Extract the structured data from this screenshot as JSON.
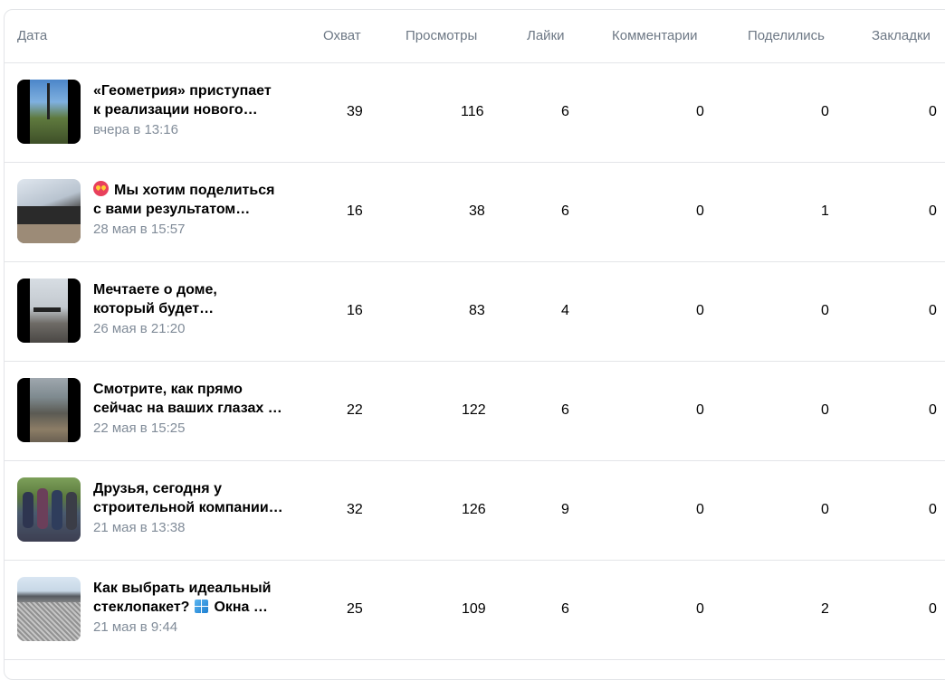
{
  "header": {
    "date": "Дата",
    "reach": "Охват",
    "views": "Просмотры",
    "likes": "Лайки",
    "comments": "Комментарии",
    "shares": "Поделились",
    "bookmarks": "Закладки"
  },
  "rows": [
    {
      "title_line1": "«Геометрия» приступает",
      "title_line2": "к реализации нового…",
      "date": "вчера в 13:16",
      "reach": "39",
      "views": "116",
      "likes": "6",
      "comments": "0",
      "shares": "0",
      "bookmarks": "0"
    },
    {
      "title_line1": "Мы хотим поделиться",
      "title_line2": "с вами результатом…",
      "date": "28 мая в 15:57",
      "reach": "16",
      "views": "38",
      "likes": "6",
      "comments": "0",
      "shares": "1",
      "bookmarks": "0",
      "emoji": "star-struck-icon"
    },
    {
      "title_line1": "Мечтаете о доме,",
      "title_line2": "который будет…",
      "date": "26 мая в 21:20",
      "reach": "16",
      "views": "83",
      "likes": "4",
      "comments": "0",
      "shares": "0",
      "bookmarks": "0"
    },
    {
      "title_line1": "Смотрите, как прямо",
      "title_line2": "сейчас на ваших глазах …",
      "date": "22 мая в 15:25",
      "reach": "22",
      "views": "122",
      "likes": "6",
      "comments": "0",
      "shares": "0",
      "bookmarks": "0"
    },
    {
      "title_line1": "Друзья, сегодня у",
      "title_line2": "строительной компании…",
      "date": "21 мая в 13:38",
      "reach": "32",
      "views": "126",
      "likes": "9",
      "comments": "0",
      "shares": "0",
      "bookmarks": "0"
    },
    {
      "title_line1": "Как выбрать идеальный",
      "title_line2a": "стеклопакет?",
      "title_line2b": "Окна …",
      "date": "21 мая в 9:44",
      "reach": "25",
      "views": "109",
      "likes": "6",
      "comments": "0",
      "shares": "2",
      "bookmarks": "0",
      "emoji": "window-icon"
    }
  ]
}
